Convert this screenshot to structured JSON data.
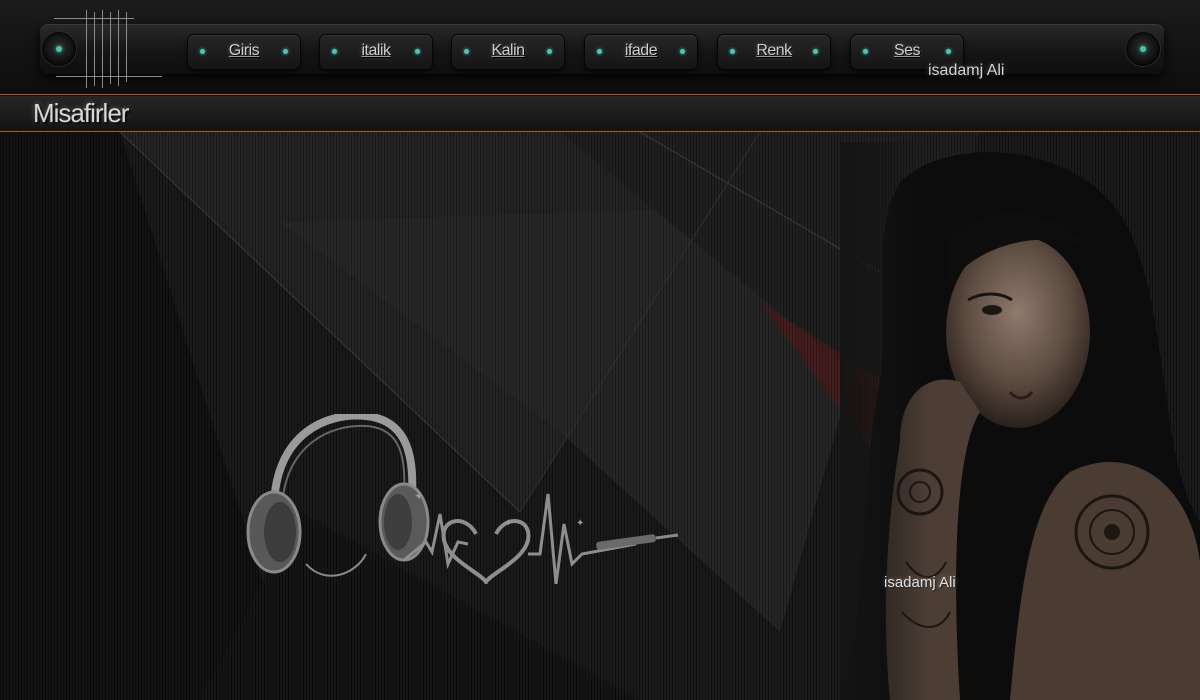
{
  "nav": {
    "items": [
      {
        "label": "Giris"
      },
      {
        "label": "italik"
      },
      {
        "label": "Kalin"
      },
      {
        "label": "ifade"
      },
      {
        "label": "Renk"
      },
      {
        "label": "Ses"
      }
    ]
  },
  "branding": {
    "signature": "isadamj Ali",
    "signature_image": "isadamj Ali"
  },
  "section": {
    "title": "Misafirler"
  },
  "colors": {
    "accent_dot": "#4cc7b3",
    "divider": "#b4581c",
    "background": "#141414"
  },
  "icons": {
    "logo": "guitar-strings-icon",
    "art": "headphones-heartbeat-icon",
    "knob": "teal-led-knob-icon"
  }
}
